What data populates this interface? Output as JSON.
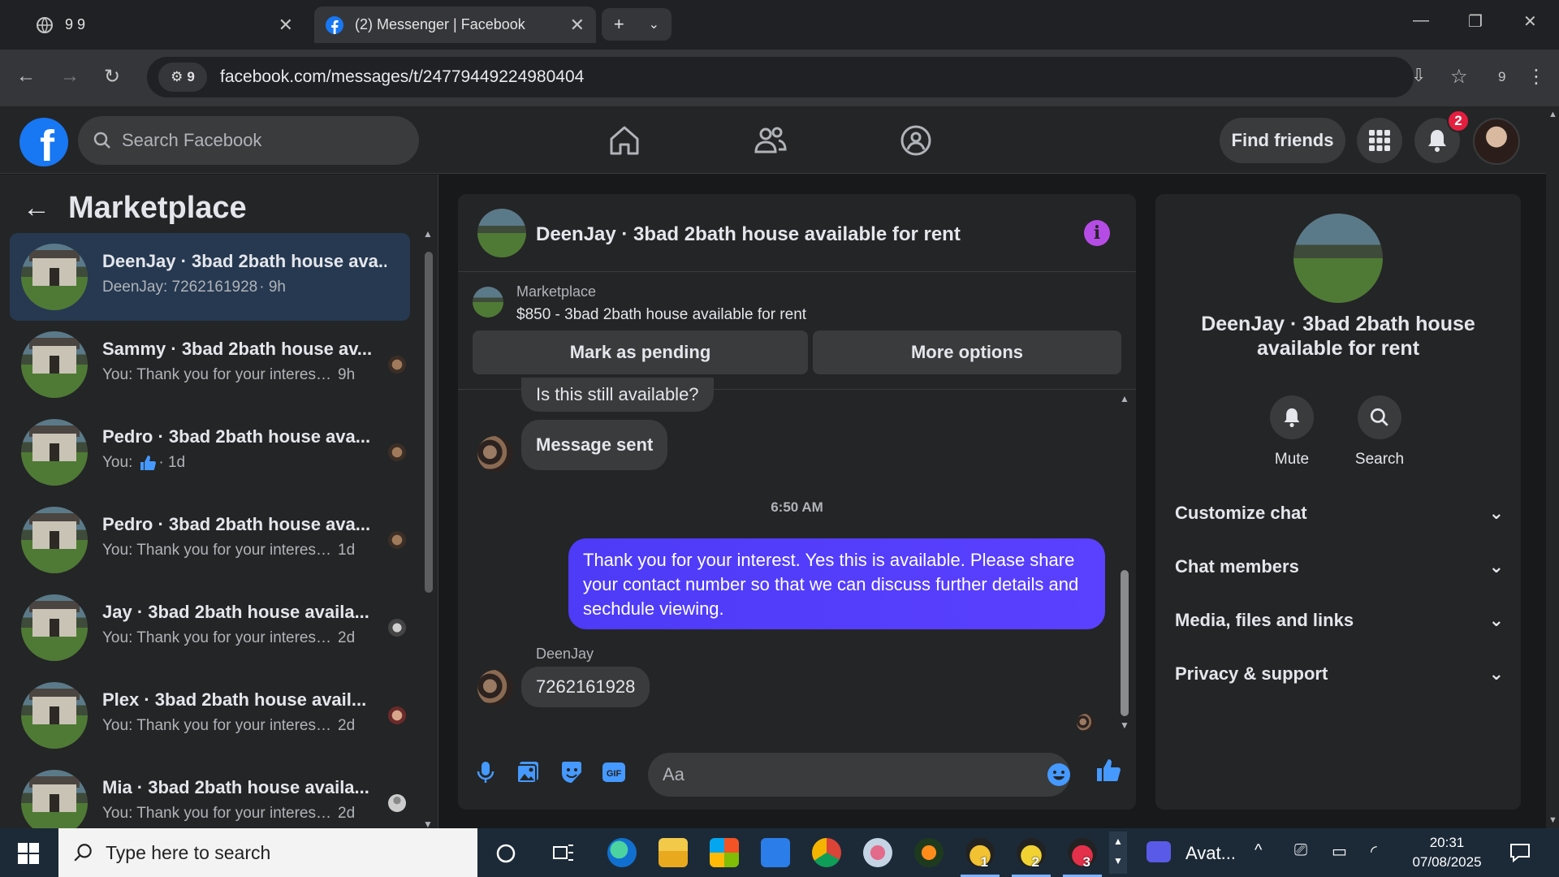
{
  "browser": {
    "tabs": [
      {
        "title": "9 9"
      },
      {
        "title": "(2) Messenger | Facebook"
      }
    ],
    "new_tab": "+",
    "url": "facebook.com/messages/t/24779449224980404",
    "site_chip_count": "9",
    "extensions_count": "9"
  },
  "facebook": {
    "search_placeholder": "Search Facebook",
    "find_friends": "Find friends",
    "notification_count": "2"
  },
  "sidebar": {
    "title": "Marketplace",
    "conversations": [
      {
        "name": "DeenJay · 3bad 2bath house ava...",
        "preview": "DeenJay: 7262161928",
        "time": "· 9h"
      },
      {
        "name": "Sammy · 3bad 2bath house av...",
        "preview": "You: Thank you for your interest....",
        "time": "9h"
      },
      {
        "name": "Pedro · 3bad 2bath house ava...",
        "preview": "You:",
        "time": "· 1d"
      },
      {
        "name": "Pedro · 3bad 2bath house ava...",
        "preview": "You: Thank you for your interest ...",
        "time": "1d"
      },
      {
        "name": "Jay · 3bad 2bath house availa...",
        "preview": "You: Thank you for your interest....",
        "time": "2d"
      },
      {
        "name": "Plex · 3bad 2bath house avail...",
        "preview": "You: Thank you for your interest....",
        "time": "2d"
      },
      {
        "name": "Mia · 3bad 2bath house availa...",
        "preview": "You: Thank you for your interest....",
        "time": "2d"
      }
    ]
  },
  "chat": {
    "title": "DeenJay · 3bad 2bath house available for rent",
    "marketplace_label": "Marketplace",
    "listing": "$850 - 3bad 2bath house available for rent",
    "mark_pending": "Mark as pending",
    "more_options": "More options",
    "messages": [
      {
        "text": "Is this still available?"
      },
      {
        "text": "Message sent"
      },
      {
        "text": "Thank you for your interest. Yes this is available. Please share your contact number so that we can discuss further details and sechdule viewing."
      },
      {
        "text": "7262161928"
      }
    ],
    "timestamp": "6:50 AM",
    "sender_name": "DeenJay",
    "composer_placeholder": "Aa"
  },
  "info_panel": {
    "name": "DeenJay · 3bad 2bath house available for rent",
    "mute": "Mute",
    "search": "Search",
    "sections": [
      "Customize chat",
      "Chat members",
      "Media, files and links",
      "Privacy & support"
    ]
  },
  "taskbar": {
    "search_placeholder": "Type here to search",
    "app_label": "Avat...",
    "time": "20:31",
    "date": "07/08/2025",
    "badges": [
      "1",
      "2",
      "3"
    ]
  },
  "colors": {
    "accent": "#1877f2",
    "outgoing_bubble": "#4d3bf7",
    "active_conversation": "#263951",
    "info_icon": "#b64ce6",
    "badge": "#e41e3f"
  }
}
